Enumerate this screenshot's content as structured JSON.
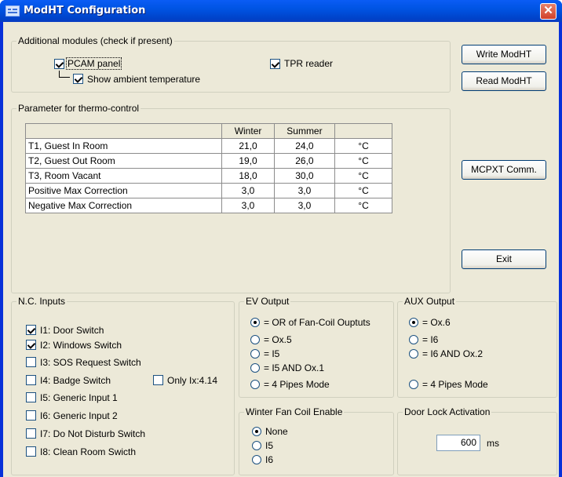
{
  "window": {
    "title": "ModHT Configuration",
    "close_glyph": "✕"
  },
  "additional_modules": {
    "label": "Additional modules (check if present)",
    "pcam_panel": {
      "label": "PCAM panel",
      "checked": true
    },
    "ambient_temp": {
      "label": "Show ambient temperature",
      "checked": true
    },
    "tpr_reader": {
      "label": "TPR reader",
      "checked": true
    }
  },
  "buttons": {
    "write": "Write ModHT",
    "read": "Read ModHT",
    "mcpxt": "MCPXT Comm.",
    "exit": "Exit"
  },
  "thermo": {
    "label": "Parameter for thermo-control",
    "columns": [
      "",
      "Winter",
      "Summer",
      ""
    ],
    "rows": [
      {
        "name": "T1, Guest In Room",
        "winter": "21,0",
        "summer": "24,0",
        "unit": "°C"
      },
      {
        "name": "T2, Guest Out Room",
        "winter": "19,0",
        "summer": "26,0",
        "unit": "°C"
      },
      {
        "name": "T3, Room Vacant",
        "winter": "18,0",
        "summer": "30,0",
        "unit": "°C"
      },
      {
        "name": "Positive Max Correction",
        "winter": "3,0",
        "summer": "3,0",
        "unit": "°C"
      },
      {
        "name": "Negative Max Correction",
        "winter": "3,0",
        "summer": "3,0",
        "unit": "°C"
      }
    ]
  },
  "nc_inputs": {
    "label": "N.C. Inputs",
    "items": [
      {
        "label": "I1: Door Switch",
        "checked": true
      },
      {
        "label": "I2: Windows Switch",
        "checked": true
      },
      {
        "label": "I3: SOS Request Switch",
        "checked": false
      },
      {
        "label": "I4: Badge Switch",
        "checked": false
      },
      {
        "label": "I5: Generic Input 1",
        "checked": false
      },
      {
        "label": "I6: Generic Input 2",
        "checked": false
      },
      {
        "label": "I7: Do Not Disturb Switch",
        "checked": false
      },
      {
        "label": "I8: Clean Room Swicth",
        "checked": false
      }
    ],
    "only_ix": {
      "label": "Only Ix:4.14",
      "checked": false
    }
  },
  "ev_output": {
    "label": "EV Output",
    "options": [
      "= OR of Fan-Coil Ouptuts",
      "= Ox.5",
      "= I5",
      "= I5  AND Ox.1",
      "= 4 Pipes Mode"
    ],
    "selected": 0
  },
  "aux_output": {
    "label": "AUX Output",
    "options": [
      "= Ox.6",
      "= I6",
      "= I6  AND Ox.2",
      "= 4 Pipes Mode"
    ],
    "selected": 0
  },
  "winter_fan": {
    "label": "Winter Fan Coil Enable",
    "options": [
      "None",
      "I5",
      "I6"
    ],
    "selected": 0
  },
  "door_lock": {
    "label": "Door Lock Activation",
    "value": "600",
    "unit": "ms"
  }
}
